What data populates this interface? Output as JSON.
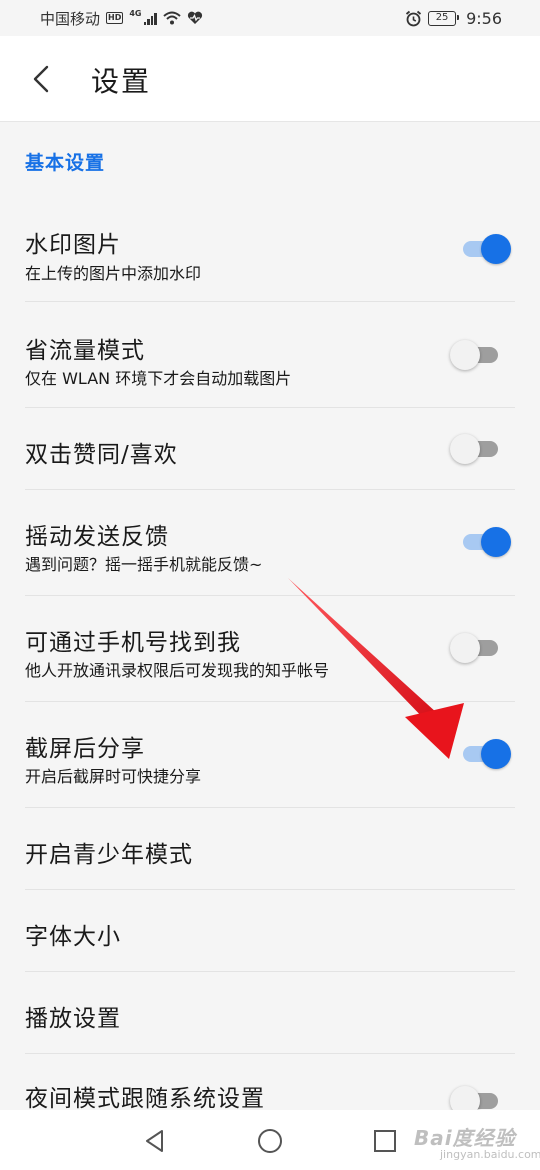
{
  "status_bar": {
    "carrier": "中国移动",
    "hd": "HD",
    "network": "4G",
    "battery": "25",
    "time": "9:56"
  },
  "header": {
    "title": "设置",
    "back_icon": "chevron-left-icon"
  },
  "section": {
    "title": "基本设置"
  },
  "settings": [
    {
      "title": "水印图片",
      "subtitle": "在上传的图片中添加水印",
      "toggle": "on"
    },
    {
      "title": "省流量模式",
      "subtitle": "仅在 WLAN 环境下才会自动加载图片",
      "toggle": "off"
    },
    {
      "title": "双击赞同/喜欢",
      "subtitle": "",
      "toggle": "off"
    },
    {
      "title": "摇动发送反馈",
      "subtitle": "遇到问题？摇一摇手机就能反馈~",
      "toggle": "on"
    },
    {
      "title": "可通过手机号找到我",
      "subtitle": "他人开放通讯录权限后可发现我的知乎帐号",
      "toggle": "off"
    },
    {
      "title": "截屏后分享",
      "subtitle": "开启后截屏时可快捷分享",
      "toggle": "on"
    },
    {
      "title": "开启青少年模式",
      "subtitle": ""
    },
    {
      "title": "字体大小",
      "subtitle": ""
    },
    {
      "title": "播放设置",
      "subtitle": ""
    },
    {
      "title": "夜间模式跟随系统设置",
      "subtitle": "",
      "toggle": "off"
    }
  ],
  "colors": {
    "accent": "#1771e6",
    "toggle_on_track": "#a8c9f2",
    "toggle_off_track": "#9e9e9e",
    "arrow": "#e8141c"
  },
  "nav_bar": {
    "back": "triangle-back-icon",
    "home": "circle-home-icon",
    "recents": "square-recents-icon"
  },
  "watermark": {
    "brand": "Bai度经验",
    "url": "jingyan.baidu.com"
  }
}
